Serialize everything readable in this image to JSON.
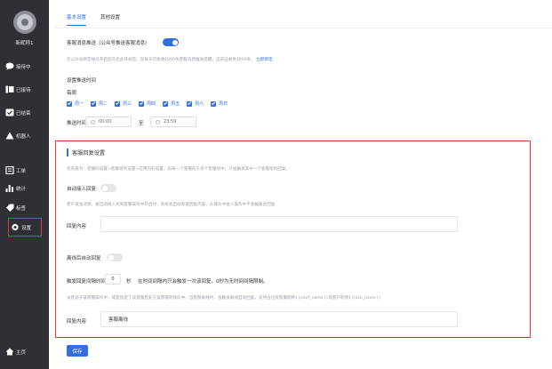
{
  "sidebar": {
    "user_name": "新昵称1",
    "items": [
      {
        "label": "接待中",
        "icon": "chat-bubble-icon"
      },
      {
        "label": "已接待",
        "icon": "list-icon"
      },
      {
        "label": "已结束",
        "icon": "check-icon"
      },
      {
        "label": "机器人",
        "icon": "robot-icon"
      },
      {
        "label": "工单",
        "icon": "ticket-icon"
      },
      {
        "label": "统计",
        "icon": "bar-chart-icon"
      },
      {
        "label": "标签",
        "icon": "tag-icon"
      },
      {
        "label": "设置",
        "icon": "gear-icon"
      },
      {
        "label": "主页",
        "icon": "home-icon"
      }
    ]
  },
  "tabs": [
    "基本设置",
    "其他设置"
  ],
  "push": {
    "label": "客服消息推送（公众号推送客服消息）",
    "enabled": true,
    "hint": "在公众号绑定账号开启后开启此开关后，您每天可接收1000条客服消息推送提醒，当前已剩余1000条。",
    "hint_link": "立即绑定"
  },
  "schedule": {
    "title": "设置推送时间",
    "subtitle": "每周",
    "days": [
      "周一",
      "周二",
      "周三",
      "周四",
      "周五",
      "周六",
      "周日"
    ],
    "time_label": "推送时间:",
    "start": "00:00",
    "separator": "至",
    "end": "23:59"
  },
  "reply": {
    "title": "客服回复设置",
    "desc": "优先级为：客服的设置>客服组的设置>应用内的设置。如果一个客服处于多个客服组中，只会触发其中一个客服组的回复。",
    "auto_access": {
      "label": "自动接入回复",
      "enabled": false,
      "hint": "客户发送消息，被自动接入到某客服操作中开启时，系统会自动发送回复内容，从排队中进入操作中不会触发此回复",
      "content_label": "回复内容",
      "content": ""
    },
    "offline": {
      "label": "离线后自动回复",
      "enabled": false,
      "interval_label": "触发回复间隔时间",
      "interval_value": "0",
      "interval_unit": "秒",
      "interval_hint": "在时间间隔内只会触发一次该回复，0秒为无时间间隔限制。",
      "hint": "访客处于该客服操作中，或是指定了该客服且处于该客服的排队中，当客服离线时，会触发离线自动回复，支持占位符客服昵称{{staff_name}}及客户昵称{{nick_name}}",
      "content_label": "回复内容",
      "content": "客服离线"
    }
  },
  "save_label": "保存"
}
